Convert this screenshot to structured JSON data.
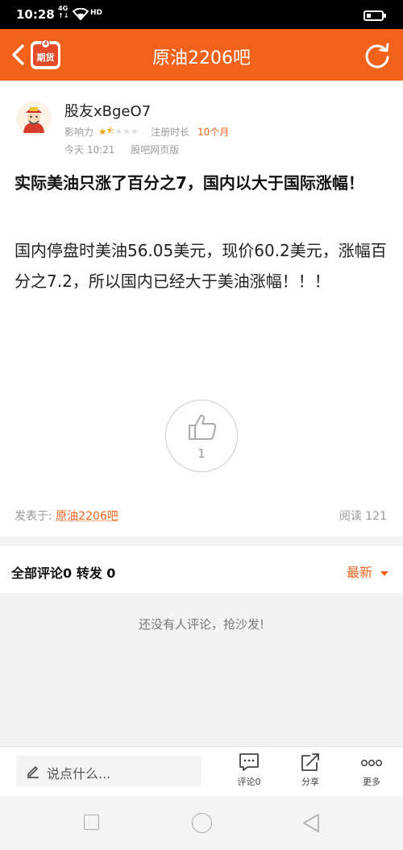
{
  "status_bar": {
    "time": "10:28",
    "network": "4G",
    "network_speed": "↑↓",
    "hd": "HD",
    "battery_level": 0.2
  },
  "header": {
    "title": "原油2206吧",
    "logo_text": "期货",
    "logo_badge": "4",
    "accent_color": "#f3621b"
  },
  "author": {
    "name": "股友xBgeO7",
    "influence_label": "影响力",
    "influence_stars": 1.5,
    "stars_total": 5,
    "registered_label": "注册时长",
    "registered_value": "10个月",
    "post_time": "今天 10:21",
    "source": "股吧网页版"
  },
  "post": {
    "title": "实际美油只涨了百分之7，国内以大于国际涨幅！",
    "body": "国内停盘时美油56.05美元，现价60.2美元，涨幅百分之7.2，所以国内已经大于美油涨幅！！！",
    "like_count": "1",
    "posted_in_label": "发表于:",
    "posted_in_bar": "原油2206吧",
    "reads": "阅读 121"
  },
  "comments": {
    "tab_label": "全部评论0 转发 0",
    "sort_label": "最新",
    "empty_text": "还没有人评论，抢沙发!"
  },
  "action_bar": {
    "input_placeholder": "说点什么...",
    "comment_label": "评论0",
    "share_label": "分享",
    "more_label": "更多"
  }
}
